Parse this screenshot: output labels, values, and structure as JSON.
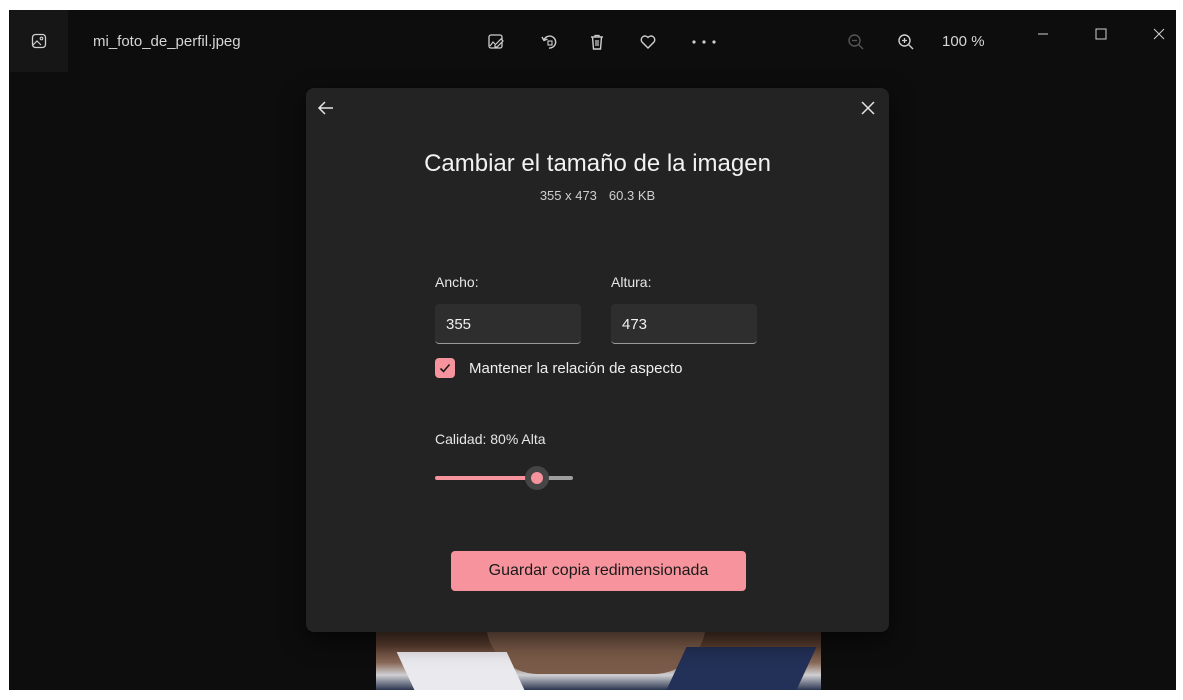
{
  "titlebar": {
    "filename": "mi_foto_de_perfil.jpeg",
    "zoom": "100 %",
    "icons": [
      "image-app-icon",
      "edit-icon",
      "rotate-icon",
      "delete-icon",
      "favorite-icon",
      "more-icon",
      "zoom-out-icon",
      "zoom-in-icon",
      "minimize-icon",
      "maximize-icon",
      "close-icon"
    ]
  },
  "dialog": {
    "title": "Cambiar el tamaño de la imagen",
    "dimensions": "355 x 473",
    "filesize": "60.3 KB",
    "width_label": "Ancho:",
    "width_value": "355",
    "height_label": "Altura:",
    "height_value": "473",
    "aspect_label": "Mantener la relación de aspecto",
    "aspect_checked": true,
    "quality_label": "Calidad: 80% Alta",
    "quality_percent": 80,
    "save_label": "Guardar copia redimensionada"
  },
  "colors": {
    "accent": "#f7939c",
    "dialog_bg": "#232323",
    "window_bg": "#0d0d0d"
  }
}
